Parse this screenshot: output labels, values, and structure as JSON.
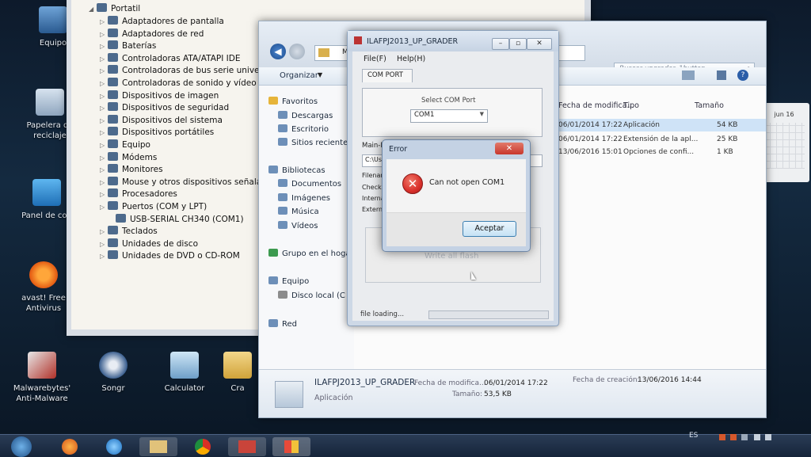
{
  "desktop": {
    "icons": [
      {
        "label": "Equipo"
      },
      {
        "label": "Papelera de reciclaje"
      },
      {
        "label": "Panel de con"
      },
      {
        "label": "avast! Free Antivirus"
      },
      {
        "label": "Malwarebytes' Anti-Malware"
      },
      {
        "label": "Songr"
      },
      {
        "label": "Calculator"
      },
      {
        "label": "Cra"
      }
    ]
  },
  "device_manager": {
    "root": "Portatil",
    "items": [
      "Adaptadores de pantalla",
      "Adaptadores de red",
      "Baterías",
      "Controladoras ATA/ATAPI IDE",
      "Controladoras de bus serie universal",
      "Controladoras de sonido y vídeo y dis",
      "Dispositivos de imagen",
      "Dispositivos de seguridad",
      "Dispositivos del sistema",
      "Dispositivos portátiles",
      "Equipo",
      "Módems",
      "Monitores",
      "Mouse y otros dispositivos señaladore",
      "Procesadores",
      "Puertos (COM y LPT)",
      "USB-SERIAL CH340 (COM1)",
      "Teclados",
      "Unidades de disco",
      "Unidades de DVD o CD-ROM"
    ]
  },
  "explorer": {
    "path_short": "M",
    "search_placeholder": "Buscar upgrader_1button",
    "organize_label": "Organizar",
    "nav": {
      "favoritos": "Favoritos",
      "descargas": "Descargas",
      "escritorio": "Escritorio",
      "sitios": "Sitios recientes",
      "bibliotecas": "Bibliotecas",
      "documentos": "Documentos",
      "imagenes": "Imágenes",
      "musica": "Música",
      "videos": "Vídeos",
      "grupo": "Grupo en el hogar",
      "equipo": "Equipo",
      "disco": "Disco local (C",
      "red": "Red"
    },
    "columns": {
      "fecha": "Fecha de modifica...",
      "tipo": "Tipo",
      "tamano": "Tamaño"
    },
    "rows": [
      {
        "fecha": "06/01/2014 17:22",
        "tipo": "Aplicación",
        "tamano": "54 KB"
      },
      {
        "fecha": "06/01/2014 17:22",
        "tipo": "Extensión de la apl...",
        "tamano": "25 KB"
      },
      {
        "fecha": "13/06/2016 15:01",
        "tipo": "Opciones de confi...",
        "tamano": "1 KB"
      }
    ],
    "details": {
      "name": "ILAFPJ2013_UP_GRADER",
      "type": "Aplicación",
      "modified_label": "Fecha de modifica...",
      "modified_value": "06/01/2014 17:22",
      "created_label": "Fecha de creación:",
      "created_value": "13/06/2016 14:44",
      "size_label": "Tamaño:",
      "size_value": "53,5 KB"
    }
  },
  "upgrader": {
    "title": "ILAFPJ2013_UP_GRADER",
    "menu": {
      "file": "File(F)",
      "help": "Help(H)"
    },
    "tab": "COM PORT",
    "select_label": "Select COM Port",
    "com_value": "COM1",
    "main_label": "Main-M",
    "path_value": "C:\\Us",
    "labels": {
      "filename": "Filenam",
      "checksum": "CheckS",
      "internal": "Internal",
      "external": "Externa"
    },
    "write_all_flash": "Write all flash",
    "status": "file loading..."
  },
  "error_dialog": {
    "title": "Error",
    "message": "Can not open COM1",
    "ok_label": "Aceptar"
  },
  "taskbar": {
    "lang": "ES",
    "calendar_month": "jun 16"
  },
  "colors": {
    "error_red": "#d9302b",
    "close_red": "#c8372d",
    "selection": "#cfe3f7",
    "accent_blue": "#2b5ea8"
  }
}
